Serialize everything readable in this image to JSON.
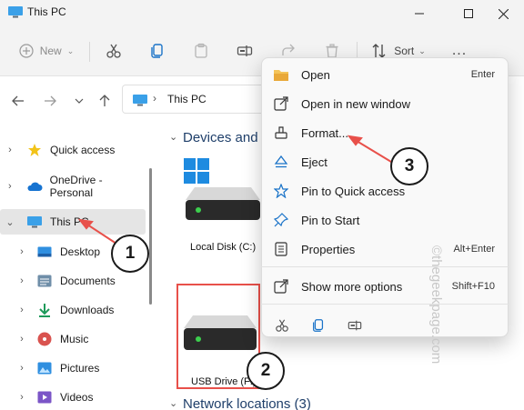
{
  "window": {
    "title": "This PC",
    "controls": [
      "minimize",
      "maximize",
      "close"
    ]
  },
  "toolbar": {
    "new_label": "New",
    "sort_label": "Sort",
    "more_label": "..."
  },
  "addressbar": {
    "path": "This PC"
  },
  "sidebar": {
    "items": [
      {
        "label": "Quick access",
        "icon": "star-icon"
      },
      {
        "label": "OneDrive - Personal",
        "icon": "cloud-icon"
      },
      {
        "label": "This PC",
        "icon": "monitor-icon",
        "selected": true
      },
      {
        "label": "Desktop",
        "icon": "desktop-icon"
      },
      {
        "label": "Documents",
        "icon": "documents-icon"
      },
      {
        "label": "Downloads",
        "icon": "downloads-icon"
      },
      {
        "label": "Music",
        "icon": "music-icon"
      },
      {
        "label": "Pictures",
        "icon": "pictures-icon"
      },
      {
        "label": "Videos",
        "icon": "videos-icon"
      }
    ]
  },
  "main": {
    "devices_header": "Devices and",
    "network_header": "Network locations (3)",
    "drives": [
      {
        "label": "Local Disk (C:)",
        "icon": "windows-drive-icon"
      },
      {
        "label": "USB Drive (F:)",
        "icon": "usb-drive-icon"
      }
    ]
  },
  "context_menu": {
    "items": [
      {
        "label": "Open",
        "shortcut": "Enter",
        "icon": "folder-open-icon"
      },
      {
        "label": "Open in new window",
        "shortcut": "",
        "icon": "external-window-icon"
      },
      {
        "label": "Format...",
        "shortcut": "",
        "icon": "format-icon"
      },
      {
        "label": "Eject",
        "shortcut": "",
        "icon": "eject-icon"
      },
      {
        "label": "Pin to Quick access",
        "shortcut": "",
        "icon": "star-outline-icon"
      },
      {
        "label": "Pin to Start",
        "shortcut": "",
        "icon": "pin-icon"
      },
      {
        "label": "Properties",
        "shortcut": "Alt+Enter",
        "icon": "properties-icon"
      },
      {
        "label": "Show more options",
        "shortcut": "Shift+F10",
        "icon": "more-options-icon"
      }
    ],
    "tools": [
      "cut-icon",
      "copy-icon",
      "rename-icon"
    ]
  },
  "annotations": {
    "step1": "1",
    "step2": "2",
    "step3": "3",
    "accent": "#e8504a"
  },
  "watermark": "©thegeekpage.com"
}
